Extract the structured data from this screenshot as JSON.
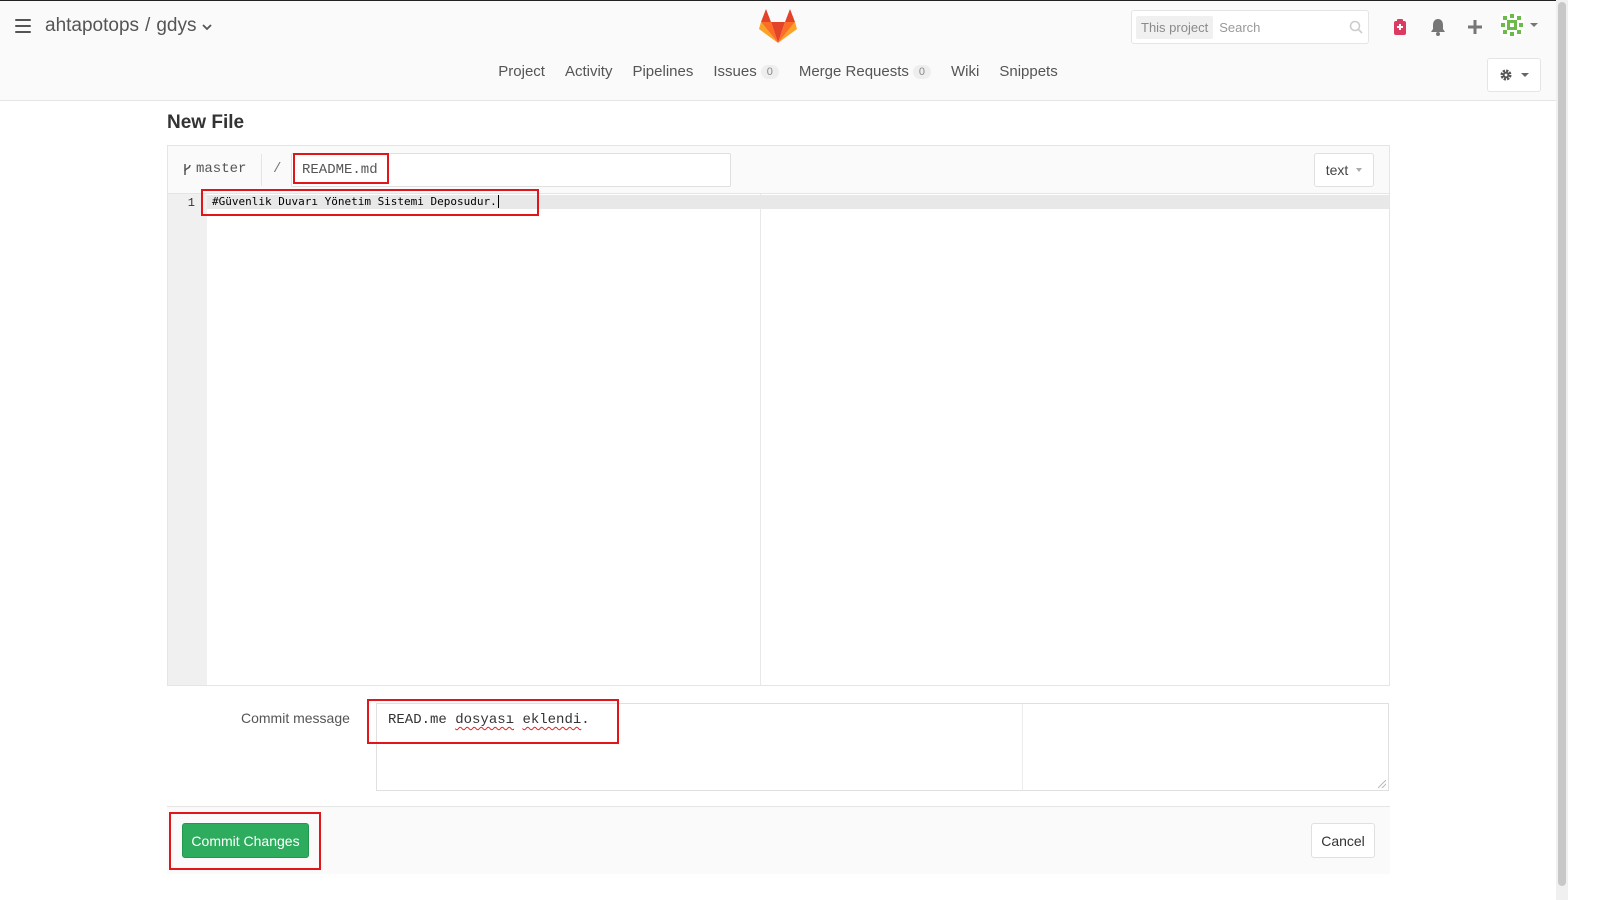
{
  "header": {
    "namespace": "ahtapotops",
    "separator": "/",
    "project": "gdys",
    "search_scope": "This project",
    "search_placeholder": "Search"
  },
  "nav": {
    "items": [
      {
        "label": "Project"
      },
      {
        "label": "Activity"
      },
      {
        "label": "Pipelines"
      },
      {
        "label": "Issues",
        "count": "0"
      },
      {
        "label": "Merge Requests",
        "count": "0"
      },
      {
        "label": "Wiki"
      },
      {
        "label": "Snippets"
      }
    ]
  },
  "page": {
    "title": "New File"
  },
  "editor": {
    "branch": "master",
    "path_separator": "/",
    "file_name": "README.md",
    "language": "text",
    "line_number": "1",
    "content_line": "#Güvenlik Duvarı Yönetim Sistemi Deposudur."
  },
  "commit": {
    "label": "Commit message",
    "message_prefix": "READ.me ",
    "message_word1": "dosyası",
    "message_space": " ",
    "message_word2": "eklendi",
    "message_suffix": ".",
    "commit_button": "Commit Changes",
    "cancel_button": "Cancel"
  },
  "colors": {
    "commit_green": "#2eac5e",
    "highlight_red": "#e0161b",
    "alert_pink": "#db3b61"
  },
  "icons": [
    "hamburger-icon",
    "gitlab-logo",
    "search-icon",
    "todo-icon",
    "bell-icon",
    "plus-icon",
    "avatar",
    "gear-icon",
    "branch-icon"
  ]
}
